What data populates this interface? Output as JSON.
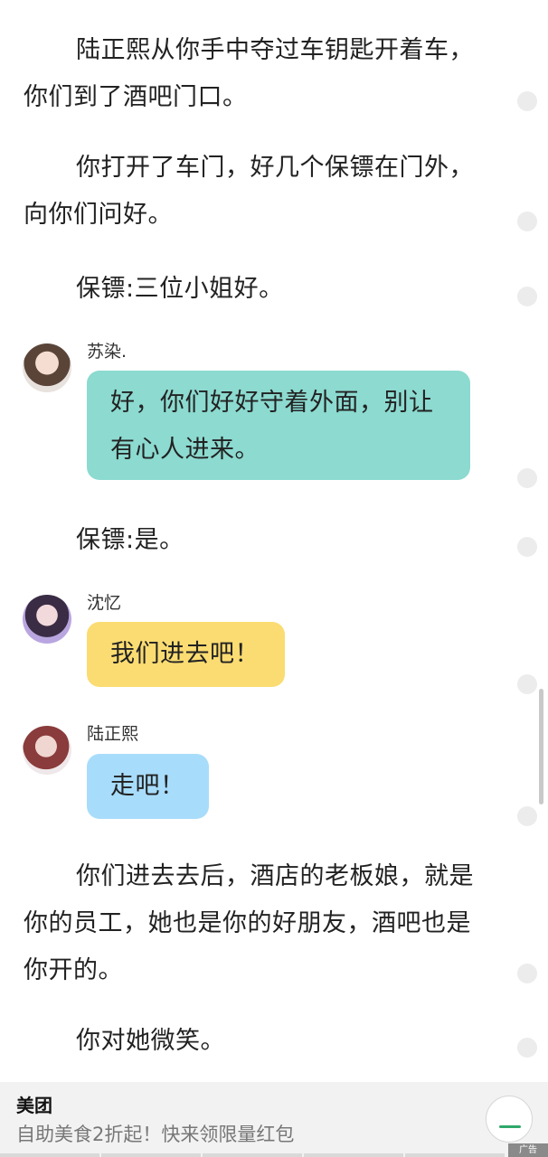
{
  "narration": [
    "陆正熙从你手中夺过车钥匙开着车，你们到了酒吧门口。",
    "你打开了车门，好几个保镖在门外，向你们问好。",
    "保镖:三位小姐好。",
    "保镖:是。",
    "你们进去去后，酒店的老板娘，就是你的员工，她也是你的好朋友，酒吧也是你开的。",
    "你对她微笑。"
  ],
  "messages": [
    {
      "speaker": "苏染.",
      "text": "好，你们好好守着外面，别让有心人进来。",
      "bubble_color": "#8cdad0"
    },
    {
      "speaker": "沈忆",
      "text": "我们进去吧！",
      "bubble_color": "#fbdc72"
    },
    {
      "speaker": "陆正熙",
      "text": "走吧！",
      "bubble_color": "#a8dcfb"
    }
  ],
  "ad": {
    "title": "美团",
    "text": "自助美食2折起！快来领限量红包",
    "tag": "广告",
    "accent": "#2ea86a"
  }
}
